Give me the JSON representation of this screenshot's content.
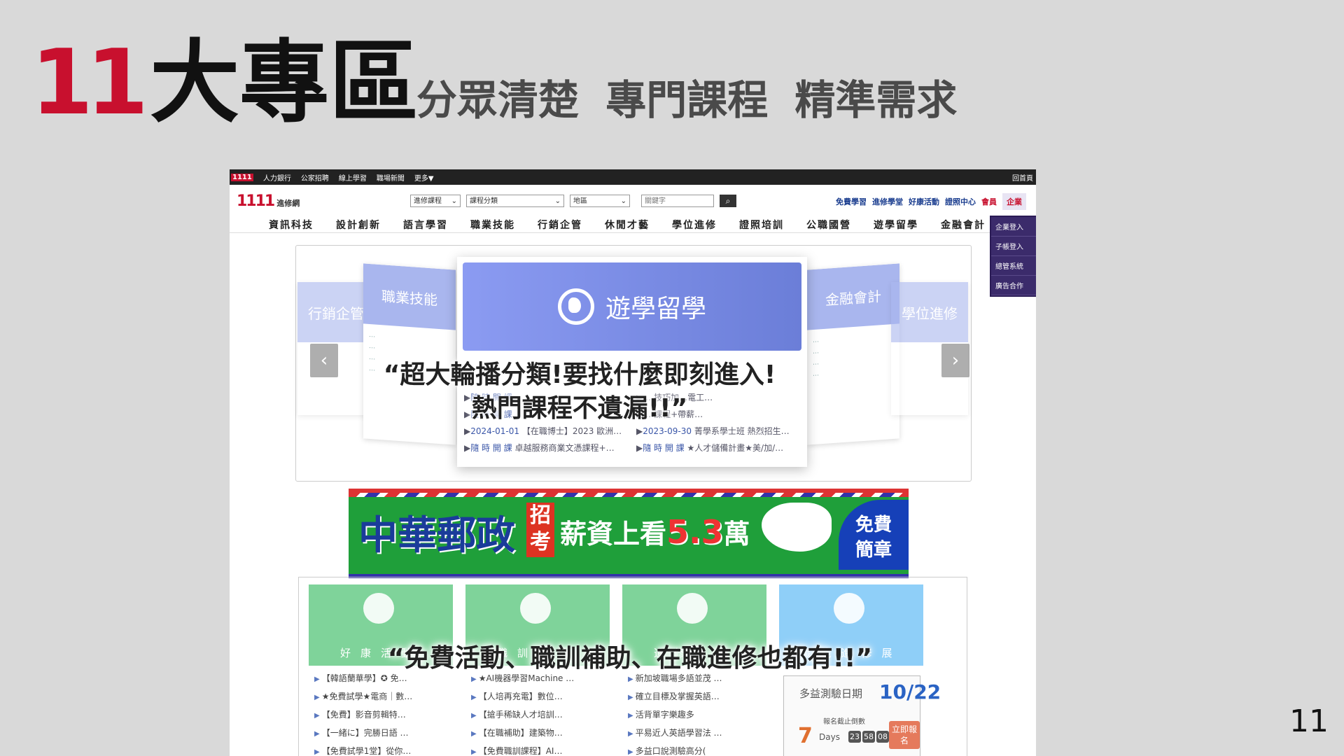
{
  "slide": {
    "title_num": "11",
    "title_main": "大專區",
    "subtitle": "分眾清楚 專門課程 精準需求",
    "page_number": "11"
  },
  "site": {
    "topbar": {
      "brand": "1111",
      "items": [
        "人力銀行",
        "公家招聘",
        "線上學習",
        "職場新聞",
        "更多▼"
      ],
      "home": "回首頁"
    },
    "logo": {
      "brand": "1111",
      "name": "進修網"
    },
    "search": {
      "select1": "進修課程",
      "select2": "課程分類",
      "select3": "地區",
      "keyword_placeholder": "關鍵字",
      "button": "⌕"
    },
    "top_links": [
      "免費學習",
      "進修學堂",
      "好康活動",
      "證照中心"
    ],
    "member": "會員",
    "enterprise": "企業",
    "enterprise_menu": [
      "企業登入",
      "子帳登入",
      "總管系統",
      "廣告合作"
    ],
    "categories": [
      "資訊科技",
      "設計創新",
      "語言學習",
      "職業技能",
      "行銷企管",
      "休閒才藝",
      "學位進修",
      "證照培訓",
      "公職國營",
      "遊學留學",
      "金融會計"
    ]
  },
  "carousel": {
    "center_title": "遊學留學",
    "side_left_far": "行銷企管",
    "side_left": "職業技能",
    "side_right": "金融會計",
    "side_right_far": "學位進修",
    "courses": [
      {
        "tag": "隨 時 開 課",
        "text": ""
      },
      {
        "tag": "",
        "text": "…技巧加…電工…"
      },
      {
        "tag": "隨 時 開 課",
        "text": ""
      },
      {
        "tag": "",
        "text": "…課程+帶薪…"
      },
      {
        "tag": "2024-01-01",
        "text": "【在職博士】2023 歐洲…"
      },
      {
        "tag": "2023-09-30",
        "text": "菁學系學士班 熱烈招生…"
      },
      {
        "tag": "隨 時 開 課",
        "text": "卓越服務商業文憑課程+…"
      },
      {
        "tag": "隨 時 開 課",
        "text": "★人才儲備計畫★美/加/…"
      }
    ],
    "prev": "‹",
    "next": "›"
  },
  "quotes": {
    "q1_line1": "“超大輪播分類!要找什麼即刻進入!",
    "q1_line2": "熱門課程不遺漏!!”",
    "q2": "“免費活動、職訓補助、在職進修也都有!!”"
  },
  "banner": {
    "main": "中華郵政",
    "tag": "招考",
    "salary_prefix": "薪資上看",
    "salary_value": "5.3",
    "salary_suffix": "萬",
    "free_line1": "免費",
    "free_line2": "簡章"
  },
  "cards": [
    {
      "title": "好康活動",
      "items": [
        "【韓語蘭華學】✪ 免…",
        "★免費試學★電商｜數…",
        "【免費】影音剪輯特…",
        "【一緒に】完勝日語 …",
        "【免費試學1堂】從你…"
      ]
    },
    {
      "title": "職訓補助",
      "items": [
        "★AI機器學習Machine …",
        "【人培再充電】數位…",
        "【搶手稀缺人才培訓…",
        "【在職補助】建築物…",
        "【免費職訓課程】AI…"
      ]
    },
    {
      "title": "進修學堂",
      "items": [
        "新加坡職場多語並茂 …",
        "確立目標及掌握英語…",
        "活背單字樂趣多",
        "平易近人英語學習法 …",
        "多益口說測驗高分("
      ]
    },
    {
      "title": "職能進修展",
      "items": []
    }
  ],
  "toeic": {
    "label": "多益測驗日期",
    "date": "10/22",
    "deadline": "報名截止倒數",
    "days": "7",
    "days_label": "Days",
    "timer": [
      "23",
      "58",
      "08"
    ],
    "button": "立即報名"
  },
  "colors": {
    "brand_red": "#c8102e",
    "background": "#d9d9d9",
    "carousel_blue": "#7b8be6"
  }
}
